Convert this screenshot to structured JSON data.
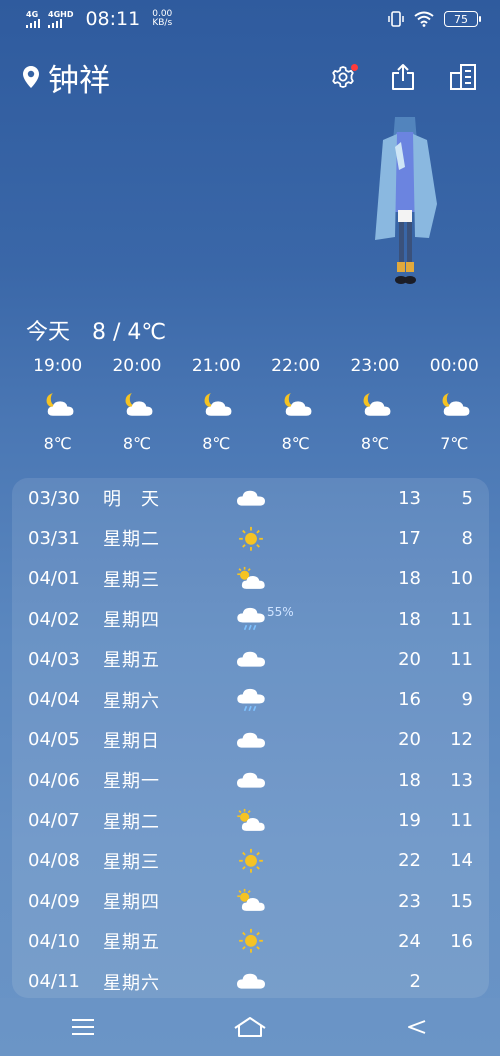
{
  "status": {
    "net1": "4G",
    "net2": "4GHD",
    "time": "08:11",
    "speed_value": "0.00",
    "speed_unit": "KB/s",
    "battery": "75"
  },
  "header": {
    "city": "钟祥"
  },
  "today": {
    "label": "今天",
    "range": "8 / 4℃"
  },
  "hourly": [
    {
      "time": "19:00",
      "icon": "partly-cloudy-night-icon",
      "temp": "8℃"
    },
    {
      "time": "20:00",
      "icon": "partly-cloudy-night-icon",
      "temp": "8℃"
    },
    {
      "time": "21:00",
      "icon": "partly-cloudy-night-icon",
      "temp": "8℃"
    },
    {
      "time": "22:00",
      "icon": "partly-cloudy-night-icon",
      "temp": "8℃"
    },
    {
      "time": "23:00",
      "icon": "partly-cloudy-night-icon",
      "temp": "8℃"
    },
    {
      "time": "00:00",
      "icon": "partly-cloudy-night-icon",
      "temp": "7℃"
    }
  ],
  "forecast": [
    {
      "date": "03/30",
      "day": "明　天",
      "icon": "cloud-icon",
      "pop": "",
      "high": "13",
      "low": "5"
    },
    {
      "date": "03/31",
      "day": "星期二",
      "icon": "sun-icon",
      "pop": "",
      "high": "17",
      "low": "8"
    },
    {
      "date": "04/01",
      "day": "星期三",
      "icon": "partly-cloudy-icon",
      "pop": "",
      "high": "18",
      "low": "10"
    },
    {
      "date": "04/02",
      "day": "星期四",
      "icon": "rain-icon",
      "pop": "55%",
      "high": "18",
      "low": "11"
    },
    {
      "date": "04/03",
      "day": "星期五",
      "icon": "cloud-icon",
      "pop": "",
      "high": "20",
      "low": "11"
    },
    {
      "date": "04/04",
      "day": "星期六",
      "icon": "rain-icon",
      "pop": "",
      "high": "16",
      "low": "9"
    },
    {
      "date": "04/05",
      "day": "星期日",
      "icon": "cloud-icon",
      "pop": "",
      "high": "20",
      "low": "12"
    },
    {
      "date": "04/06",
      "day": "星期一",
      "icon": "cloud-icon",
      "pop": "",
      "high": "18",
      "low": "13"
    },
    {
      "date": "04/07",
      "day": "星期二",
      "icon": "partly-cloudy-icon",
      "pop": "",
      "high": "19",
      "low": "11"
    },
    {
      "date": "04/08",
      "day": "星期三",
      "icon": "sun-icon",
      "pop": "",
      "high": "22",
      "low": "14"
    },
    {
      "date": "04/09",
      "day": "星期四",
      "icon": "partly-cloudy-icon",
      "pop": "",
      "high": "23",
      "low": "15"
    },
    {
      "date": "04/10",
      "day": "星期五",
      "icon": "sun-icon",
      "pop": "",
      "high": "24",
      "low": "16"
    },
    {
      "date": "04/11",
      "day": "星期六",
      "icon": "cloud-icon",
      "pop": "",
      "high": "2",
      "low": ""
    }
  ],
  "colors": {
    "accent_dot": "#ff3b3b",
    "sun": "#f5c323"
  }
}
